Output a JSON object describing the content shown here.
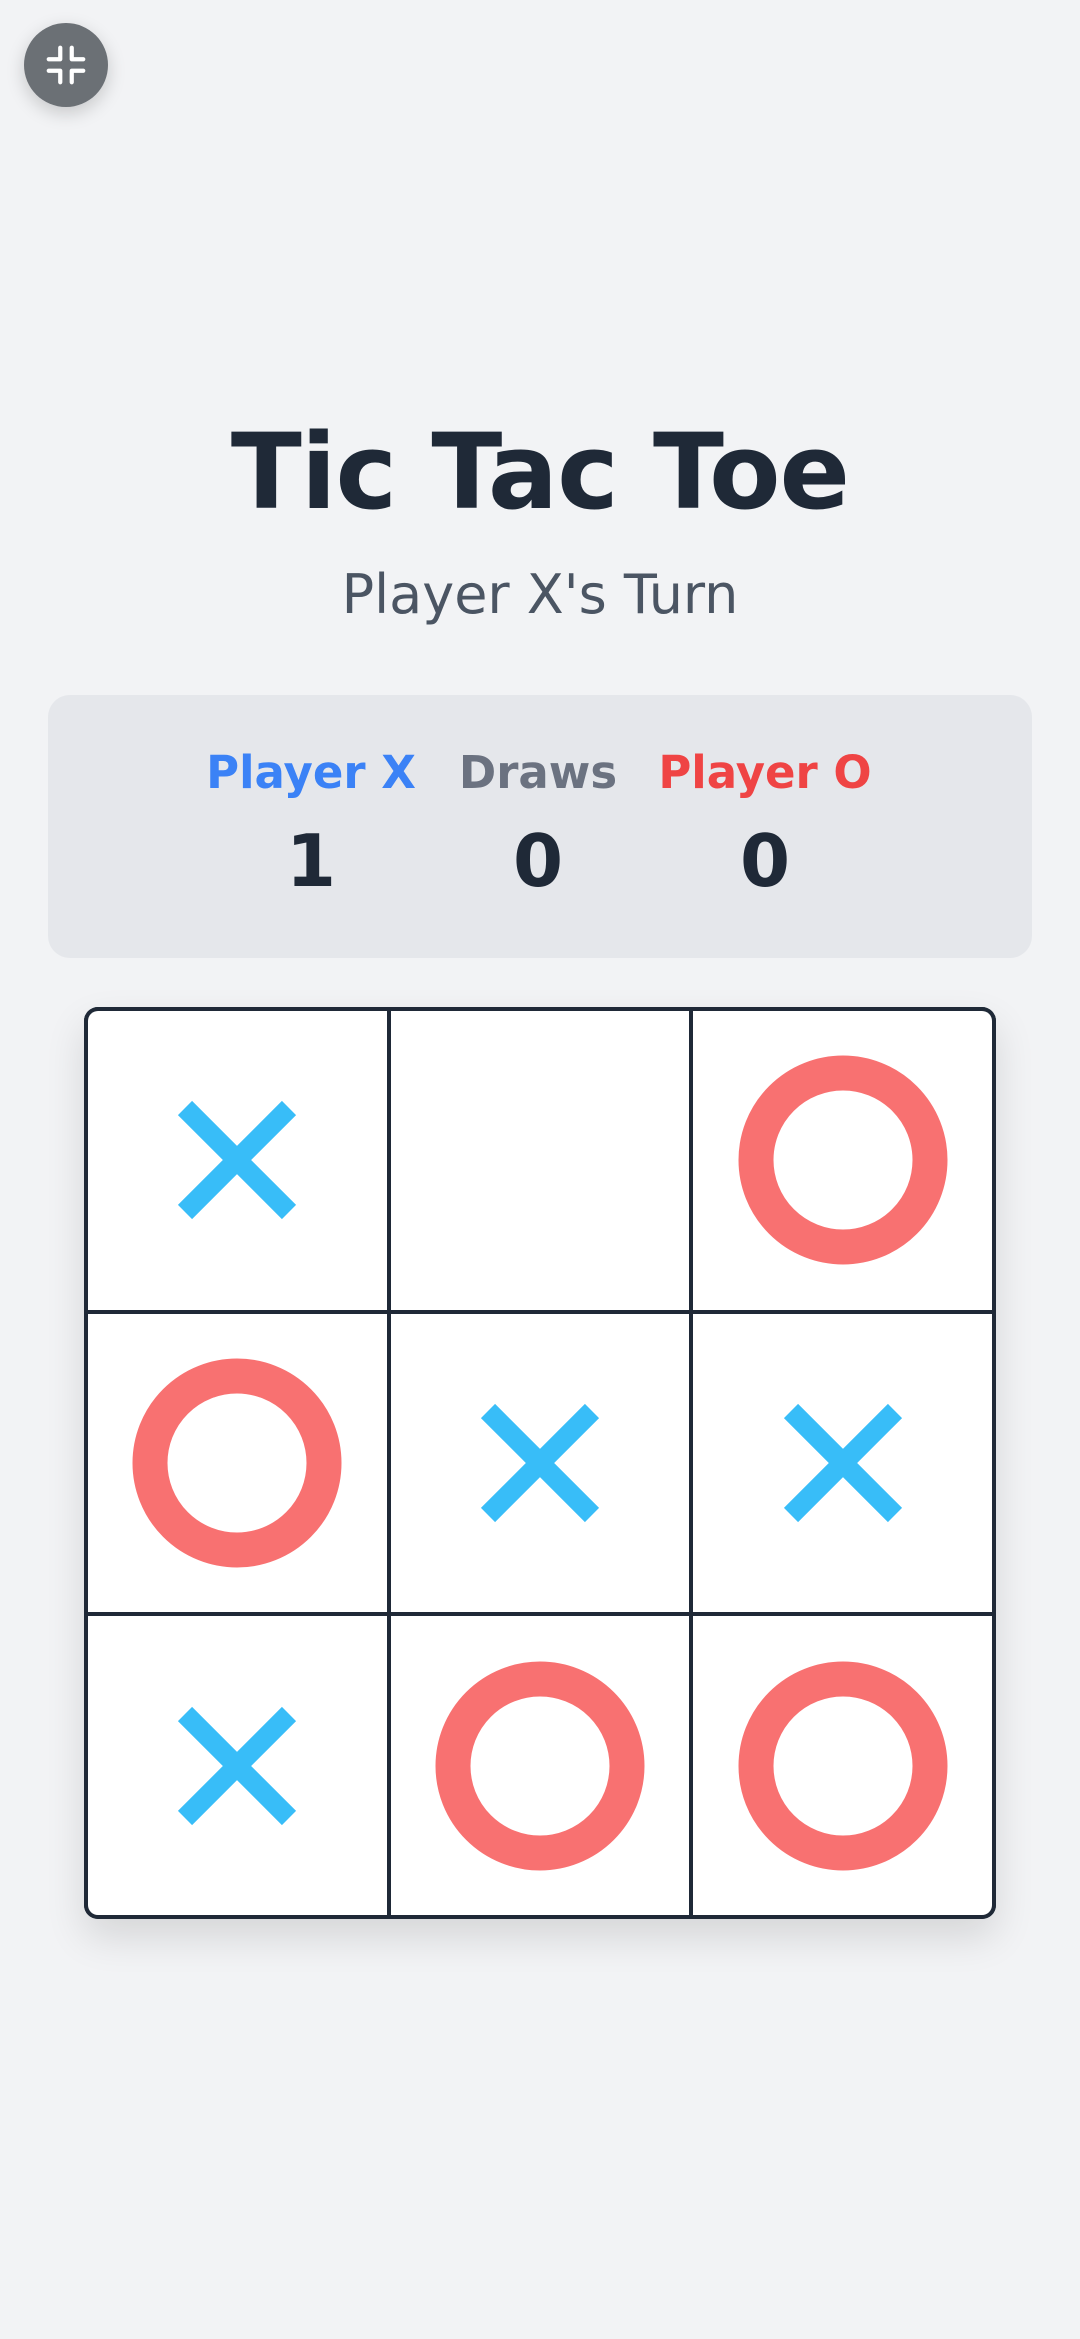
{
  "title": "Tic Tac Toe",
  "status": "Player X's Turn",
  "scoreboard": {
    "x": {
      "label": "Player X",
      "value": "1"
    },
    "draws": {
      "label": "Draws",
      "value": "0"
    },
    "o": {
      "label": "Player O",
      "value": "0"
    }
  },
  "board": [
    "X",
    "",
    "O",
    "O",
    "X",
    "X",
    "X",
    "O",
    "O"
  ],
  "colors": {
    "x_mark": "#38bdf8",
    "o_mark": "#f87171",
    "x_label": "#3b82f6",
    "o_label": "#ef4444",
    "draw_label": "#6b7280"
  },
  "icons": {
    "exit_fullscreen": "exit-fullscreen-icon"
  }
}
